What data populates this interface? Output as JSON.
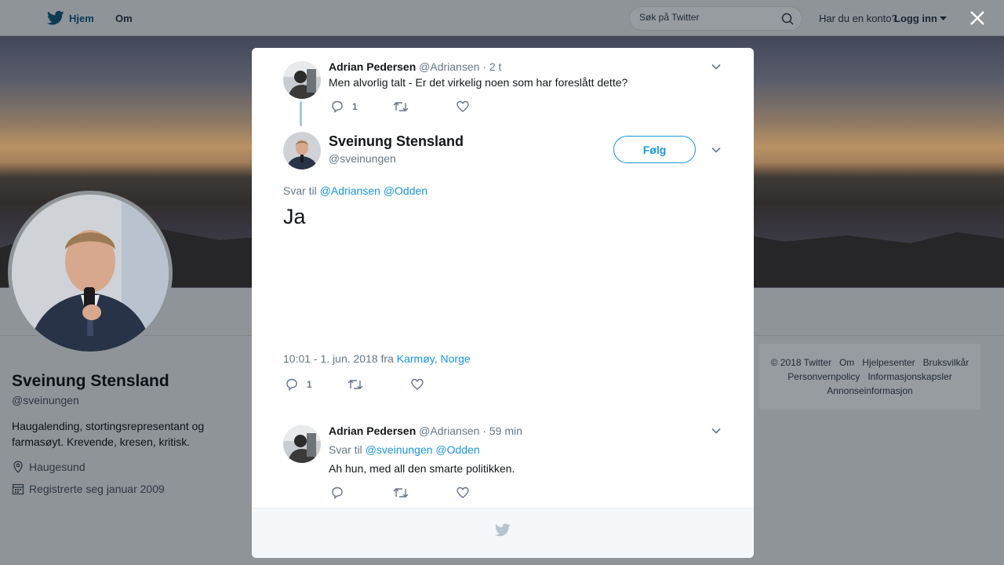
{
  "topbar": {
    "home_label": "Hjem",
    "about_label": "Om",
    "search_placeholder": "Søk på Twitter",
    "account_question": "Har du en konto?",
    "login_label": "Logg inn"
  },
  "profile": {
    "name": "Sveinung Stensland",
    "handle": "@sveinungen",
    "bio": "Haugalending, stortingsrepresentant og farmasøyt. Krevende, kresen, kritisk.",
    "location": "Haugesund",
    "joined": "Registrerte seg januar 2009"
  },
  "footer_links": [
    "© 2018 Twitter",
    "Om",
    "Hjelpesenter",
    "Bruksvilkår",
    "Personvernpolicy",
    "Informasjonskapsler",
    "Annonseinformasjon"
  ],
  "modal": {
    "parent_tweet": {
      "name": "Adrian Pedersen",
      "handle": "@Adriansen",
      "time": "· 2 t",
      "text": "Men alvorlig talt - Er det virkelig noen som har foreslått dette?",
      "reply_count": "1"
    },
    "main_tweet": {
      "name": "Sveinung Stensland",
      "handle": "@sveinungen",
      "follow_label": "Følg",
      "reply_to_label": "Svar til",
      "reply_to_mentions": "@Adriansen @Odden",
      "text": "Ja",
      "timestamp": "10:01 - 1. jun. 2018 fra",
      "location": "Karmøy, Norge",
      "reply_count": "1"
    },
    "reply_tweet": {
      "name": "Adrian Pedersen",
      "handle": "@Adriansen",
      "time": "· 59 min",
      "reply_to_label": "Svar til",
      "reply_to_mentions": "@sveinungen @Odden",
      "text": "Ah hun, med all den smarte politikken."
    }
  },
  "colors": {
    "accent": "#1b95e0",
    "muted": "#657786",
    "overlay": "#8f9499"
  }
}
